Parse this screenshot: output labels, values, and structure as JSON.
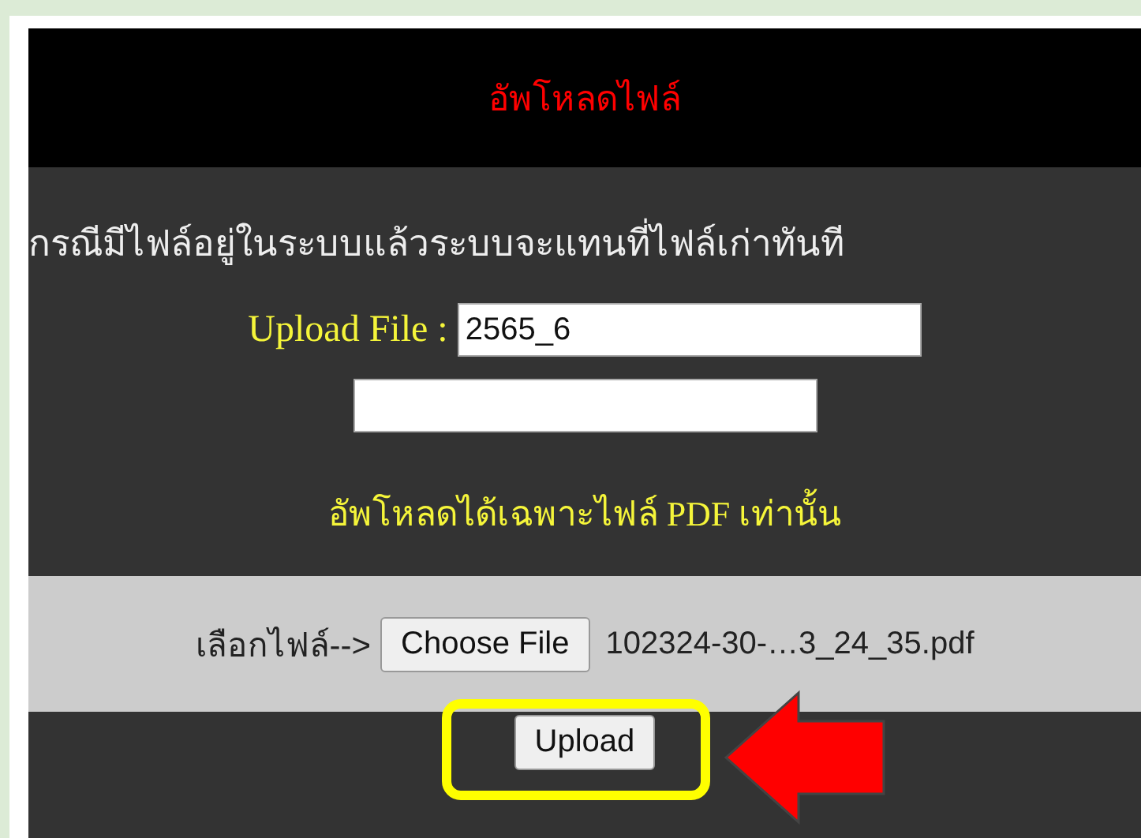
{
  "header": {
    "title": "อัพโหลดไฟล์"
  },
  "notice": "กรณีมีไฟล์อยู่ในระบบแล้วระบบจะแทนที่ไฟล์เก่าทันที",
  "upload_file": {
    "label": "Upload File :",
    "value": "2565_6"
  },
  "pdf_note": "อัพโหลดได้เฉพาะไฟล์ PDF เท่านั้น",
  "file_picker": {
    "label": "เลือกไฟล์-->",
    "button": "Choose File",
    "file_name": "102324-30-…3_24_35.pdf"
  },
  "upload_button": "Upload"
}
